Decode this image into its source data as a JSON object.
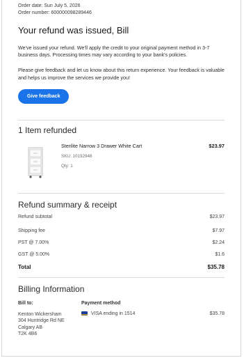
{
  "order": {
    "date_text": "Order date: Sun July 5, 2026",
    "number_text": "Order number: 600000098289446"
  },
  "hero": {
    "title": "Your refund was issued, Bill",
    "paragraph1": "We've issued your refund. We'll apply the credit to your original payment method in 3-7 business days. Processing times may vary according to your bank's policies.",
    "paragraph2": "Please give feedback and let us know about this return experience. Your feedback is valuable and helps us improve the services we provide you!",
    "feedback_button": "Give feedback",
    "button_color": "#1a73e8"
  },
  "items_section": {
    "title": "1 Item refunded",
    "items": [
      {
        "name": "Sterilite Narrow 3 Drawer White Cart",
        "sku": "SKU: 10192948",
        "qty": "Qty: 1",
        "price": "$23.97",
        "image_icon": "drawer-cart-image"
      }
    ]
  },
  "summary": {
    "title": "Refund summary & receipt",
    "rows": [
      {
        "label": "Refund subtotal",
        "value": "$23.97"
      },
      {
        "label": "Shipping fee",
        "value": "$7.97"
      },
      {
        "label": "PST @ 7.00%",
        "value": "$2.24"
      },
      {
        "label": "GST @ 5.00%",
        "value": "$1.6"
      }
    ],
    "total_label": "Total",
    "total_value": "$35.78"
  },
  "billing": {
    "title": "Billing Information",
    "bill_to_label": "Bill to:",
    "address_lines": [
      "Kenton Wickersham",
      "304 Huntridge Rd NE",
      "Calgary AB",
      "T2K 4B6"
    ],
    "payment_label": "Payment method",
    "card_text": "VISA ending in 1514",
    "card_icon": "visa-card-icon",
    "amount": "$35.78"
  }
}
